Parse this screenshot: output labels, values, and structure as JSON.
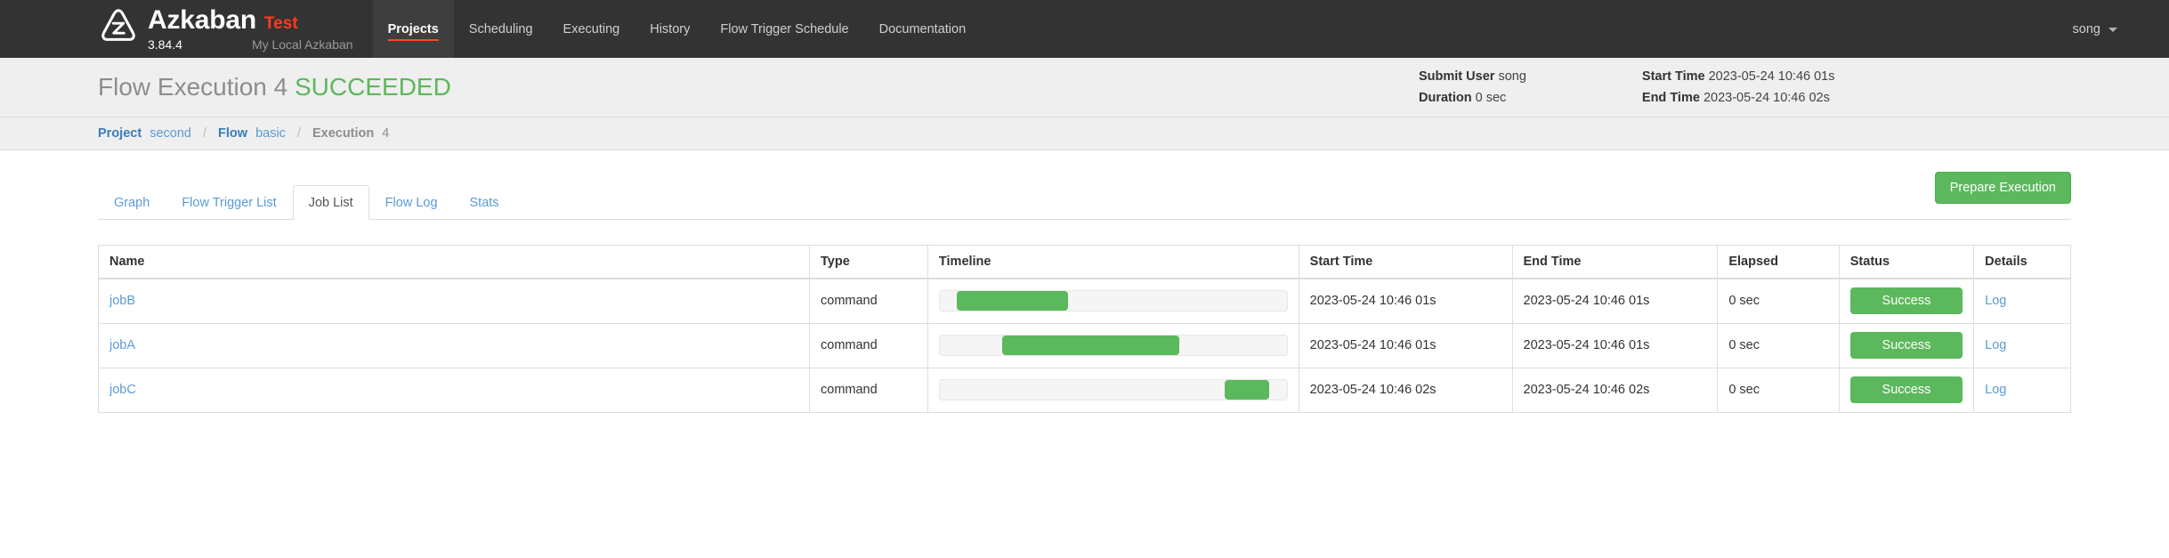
{
  "navbar": {
    "logo_icon": "azkaban-triangle-logo",
    "brand_name": "Azkaban",
    "brand_env": "Test",
    "version": "3.84.4",
    "tagline": "My Local Azkaban",
    "links": [
      {
        "label": "Projects",
        "active": true
      },
      {
        "label": "Scheduling",
        "active": false
      },
      {
        "label": "Executing",
        "active": false
      },
      {
        "label": "History",
        "active": false
      },
      {
        "label": "Flow Trigger Schedule",
        "active": false
      },
      {
        "label": "Documentation",
        "active": false
      }
    ],
    "user": "song",
    "user_caret_icon": "chevron-down-icon"
  },
  "exec_header": {
    "title": "Flow Execution 4",
    "status": "SUCCEEDED",
    "status_color": "#5cb85c",
    "summary": [
      [
        {
          "key": "Submit User",
          "value": "song"
        },
        {
          "key": "Duration",
          "value": "0 sec"
        }
      ],
      [
        {
          "key": "Start Time",
          "value": "2023-05-24 10:46 01s"
        },
        {
          "key": "End Time",
          "value": "2023-05-24 10:46 02s"
        }
      ]
    ]
  },
  "breadcrumb": [
    {
      "key": "Project",
      "value": "second",
      "current": false
    },
    {
      "key": "Flow",
      "value": "basic",
      "current": false
    },
    {
      "key": "Execution",
      "value": "4",
      "current": true
    }
  ],
  "breadcrumb_separator": "/",
  "tabs": [
    {
      "label": "Graph",
      "active": false
    },
    {
      "label": "Flow Trigger List",
      "active": false
    },
    {
      "label": "Job List",
      "active": true
    },
    {
      "label": "Flow Log",
      "active": false
    },
    {
      "label": "Stats",
      "active": false
    }
  ],
  "prepare_button": "Prepare Execution",
  "table": {
    "headers": [
      "Name",
      "Type",
      "Timeline",
      "Start Time",
      "End Time",
      "Elapsed",
      "Status",
      "Details"
    ],
    "rows": [
      {
        "name": "jobB",
        "type": "command",
        "timeline": {
          "offset_pct": 5,
          "width_pct": 32
        },
        "start_time": "2023-05-24 10:46 01s",
        "end_time": "2023-05-24 10:46 01s",
        "elapsed": "0 sec",
        "status": "Success",
        "details": "Log"
      },
      {
        "name": "jobA",
        "type": "command",
        "timeline": {
          "offset_pct": 18,
          "width_pct": 51
        },
        "start_time": "2023-05-24 10:46 01s",
        "end_time": "2023-05-24 10:46 01s",
        "elapsed": "0 sec",
        "status": "Success",
        "details": "Log"
      },
      {
        "name": "jobC",
        "type": "command",
        "timeline": {
          "offset_pct": 82,
          "width_pct": 13
        },
        "start_time": "2023-05-24 10:46 02s",
        "end_time": "2023-05-24 10:46 02s",
        "elapsed": "0 sec",
        "status": "Success",
        "details": "Log"
      }
    ]
  },
  "colors": {
    "navbar_bg": "#333333",
    "navbar_active_bg": "#3e3e3e",
    "accent_orange": "#ff4719",
    "success_green": "#5cb85c",
    "link_blue": "#5b9bd5",
    "header_bg": "#efefef"
  }
}
